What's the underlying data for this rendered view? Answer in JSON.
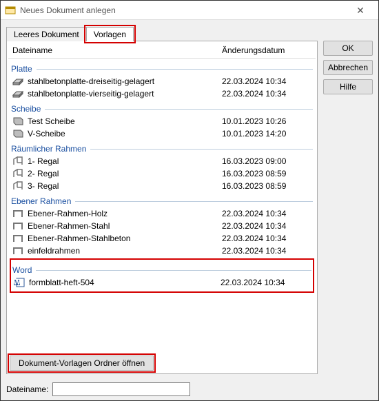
{
  "titlebar": {
    "title": "Neues Dokument anlegen"
  },
  "tabs": {
    "empty": "Leeres Dokument",
    "templates": "Vorlagen"
  },
  "columns": {
    "name": "Dateiname",
    "date": "Änderungsdatum"
  },
  "groups": [
    {
      "label": "Platte",
      "icon": "slab-icon",
      "items": [
        {
          "name": "stahlbetonplatte-dreiseitig-gelagert",
          "date": "22.03.2024 10:34"
        },
        {
          "name": "stahlbetonplatte-vierseitig-gelagert",
          "date": "22.03.2024 10:34"
        }
      ]
    },
    {
      "label": "Scheibe",
      "icon": "pane-icon",
      "items": [
        {
          "name": "Test Scheibe",
          "date": "10.01.2023 10:26"
        },
        {
          "name": "V-Scheibe",
          "date": "10.01.2023 14:20"
        }
      ]
    },
    {
      "label": "Räumlicher Rahmen",
      "icon": "frame3d-icon",
      "items": [
        {
          "name": "1- Regal",
          "date": "16.03.2023 09:00"
        },
        {
          "name": "2- Regal",
          "date": "16.03.2023 08:59"
        },
        {
          "name": "3- Regal",
          "date": "16.03.2023 08:59"
        }
      ]
    },
    {
      "label": "Ebener Rahmen",
      "icon": "frame2d-icon",
      "items": [
        {
          "name": "Ebener-Rahmen-Holz",
          "date": "22.03.2024 10:34"
        },
        {
          "name": "Ebener-Rahmen-Stahl",
          "date": "22.03.2024 10:34"
        },
        {
          "name": "Ebener-Rahmen-Stahlbeton",
          "date": "22.03.2024 10:34"
        },
        {
          "name": "einfeldrahmen",
          "date": "22.03.2024 10:34"
        }
      ]
    },
    {
      "label": "Word",
      "icon": "word-icon",
      "highlight": true,
      "items": [
        {
          "name": "formblatt-heft-504",
          "date": "22.03.2024 10:34"
        }
      ]
    }
  ],
  "buttons": {
    "ok": "OK",
    "cancel": "Abbrechen",
    "help": "Hilfe",
    "open_folder": "Dokument-Vorlagen Ordner öffnen"
  },
  "footer": {
    "filename_label": "Dateiname:",
    "filename_value": ""
  }
}
